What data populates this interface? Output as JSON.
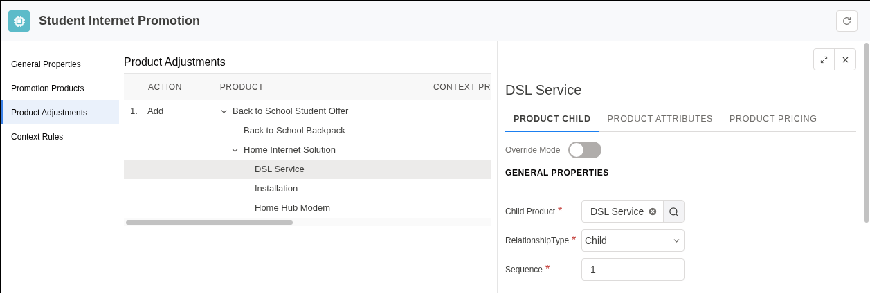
{
  "header": {
    "title": "Student Internet Promotion"
  },
  "sidebar": {
    "items": [
      {
        "label": "General Properties",
        "selected": false
      },
      {
        "label": "Promotion Products",
        "selected": false
      },
      {
        "label": "Product Adjustments",
        "selected": true
      },
      {
        "label": "Context Rules",
        "selected": false
      }
    ]
  },
  "main": {
    "title": "Product Adjustments",
    "columns": [
      "ACTION",
      "PRODUCT",
      "CONTEXT PR"
    ],
    "rows": [
      {
        "number": "1.",
        "action": "Add",
        "product": {
          "label": "Back to School Student Offer",
          "expanded": true,
          "selected": false,
          "children": [
            {
              "label": "Back to School Backpack",
              "selected": false
            },
            {
              "label": "Home Internet Solution",
              "expanded": true,
              "selected": false,
              "children": [
                {
                  "label": "DSL Service",
                  "selected": true
                },
                {
                  "label": "Installation",
                  "selected": false
                },
                {
                  "label": "Home Hub Modem",
                  "selected": false
                }
              ]
            }
          ]
        }
      }
    ]
  },
  "panel": {
    "title": "DSL Service",
    "tabs": [
      {
        "label": "PRODUCT CHILD",
        "selected": true
      },
      {
        "label": "PRODUCT ATTRIBUTES",
        "selected": false
      },
      {
        "label": "PRODUCT PRICING",
        "selected": false
      }
    ],
    "override_mode": {
      "label": "Override Mode",
      "on": false
    },
    "section": "GENERAL PROPERTIES",
    "fields": [
      {
        "kind": "lookup",
        "label": "Child Product",
        "required_mark": "*",
        "value": "DSL Service"
      },
      {
        "kind": "select",
        "label": "RelationshipType",
        "required_mark": "*",
        "value": "Child"
      },
      {
        "kind": "text",
        "label": "Sequence",
        "required_mark": "*",
        "value": "1"
      }
    ]
  }
}
